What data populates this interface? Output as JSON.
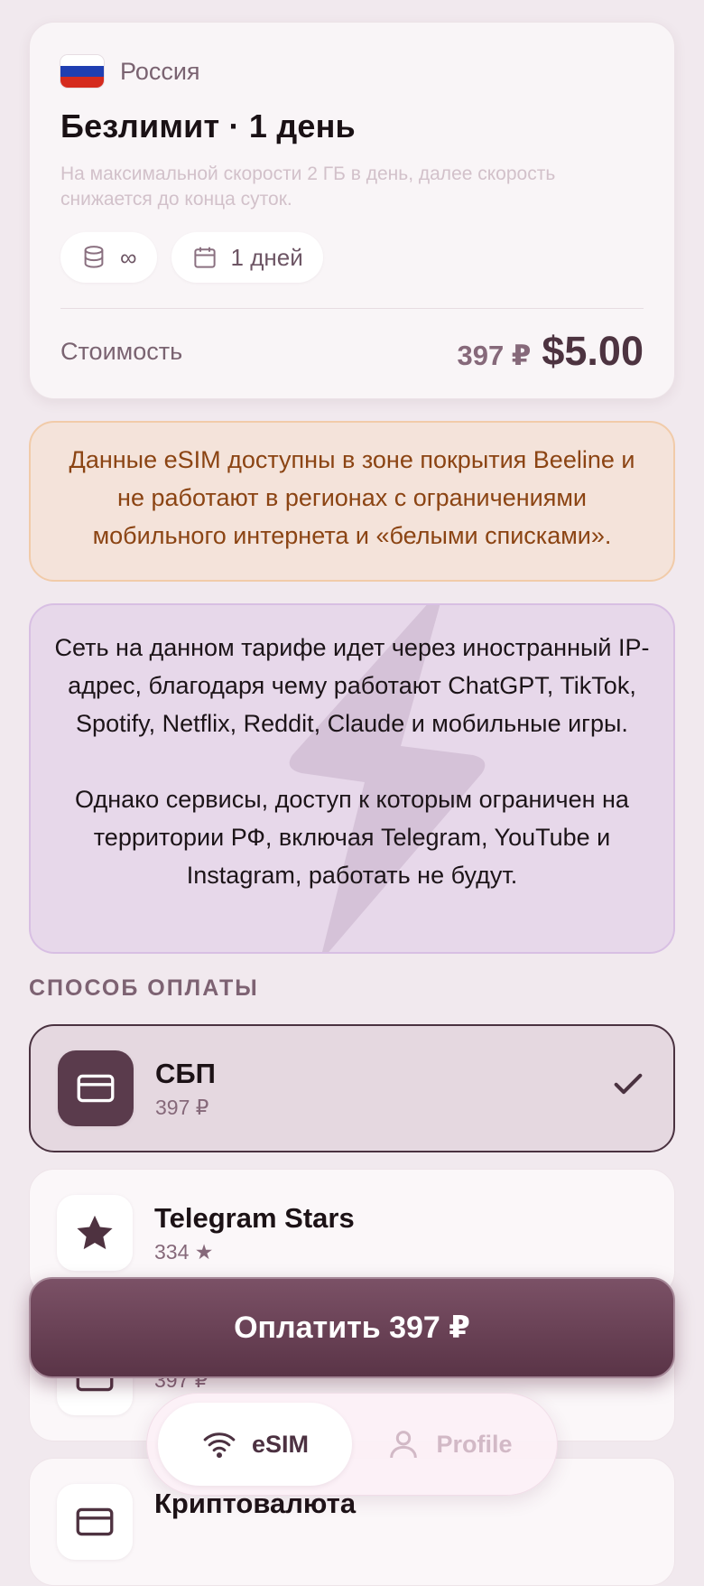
{
  "plan": {
    "country": "Россия",
    "title": "Безлимит · 1 день",
    "description": "На максимальной скорости 2 ГБ в день, далее скорость снижается до конца суток.",
    "data_chip": "∞",
    "days_chip": "1 дней",
    "price_label": "Стоимость",
    "price_rub": "397 ₽",
    "price_usd": "$5.00"
  },
  "notices": {
    "coverage": "Данные eSIM доступны в зоне покрытия Beeline и не работают в регионах с ограничениями мобильного интернета и «белыми списками».",
    "network_p1": "Сеть на данном тарифе идет через иностранный IP-адрес, благодаря чему работают ChatGPT, TikTok, Spotify, Netflix, Reddit, Claude и мобильные игры.",
    "network_p2": "Однако сервисы, доступ к которым ограничен на территории РФ, включая Telegram, YouTube и Instagram, работать не будут."
  },
  "payment": {
    "section_title": "СПОСОБ ОПЛАТЫ",
    "methods": [
      {
        "name": "СБП",
        "sub": "397 ₽",
        "icon": "card-icon",
        "selected": true
      },
      {
        "name": "Telegram Stars",
        "sub": "334 ★",
        "icon": "star-icon",
        "selected": false
      },
      {
        "name": "",
        "sub": "397 ₽",
        "icon": "card-icon",
        "selected": false
      },
      {
        "name": "Криптовалюта",
        "sub": "",
        "icon": "card-icon",
        "selected": false
      }
    ],
    "pay_button": "Оплатить 397 ₽"
  },
  "nav": {
    "esim": "eSIM",
    "profile": "Profile"
  },
  "colors": {
    "accent": "#5a3447",
    "background": "#f1e9ee",
    "coverage_text": "#8b4413",
    "coverage_bg": "#f4e3da",
    "network_bg": "#e7d8ea"
  }
}
